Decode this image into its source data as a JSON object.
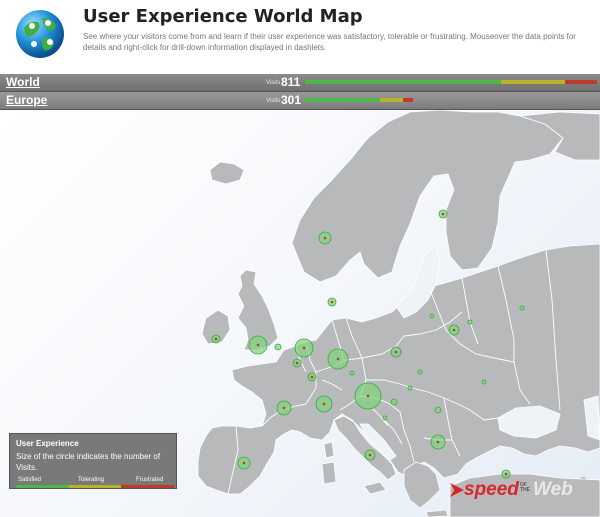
{
  "header": {
    "title": "User Experience World Map",
    "description": "See where your visitors come from and learn if their user experience was satisfactory, tolerable or frustrating. Mouseover the data points for details and right-click for drill-down information displayed in dashlets."
  },
  "nav": [
    {
      "label": "World",
      "visits_label": "Visits",
      "visits": "811",
      "satisfied": 0.67,
      "tolerating": 0.22,
      "frustrated": 0.11
    },
    {
      "label": "Europe",
      "visits_label": "Visits",
      "visits": "301",
      "satisfied": 0.69,
      "tolerating": 0.22,
      "frustrated": 0.09
    }
  ],
  "legend": {
    "title": "User Experience",
    "description": "Size of the circle indicates the number of Visits.",
    "satisfied": "Satisfied",
    "tolerating": "Tolerating",
    "frustrated": "Frustrated"
  },
  "logo": {
    "speed": "speed",
    "of": "OF",
    "the": "THE",
    "web": "Web",
    "tm": "™"
  },
  "colors": {
    "satisfied": "#4cb848",
    "tolerating": "#b8b32a",
    "frustrated": "#c0392b",
    "land": "#b7b9bb",
    "border": "#ffffff",
    "bubble_fill": "#7ed67a",
    "bubble_stroke": "#3aa83a"
  }
}
